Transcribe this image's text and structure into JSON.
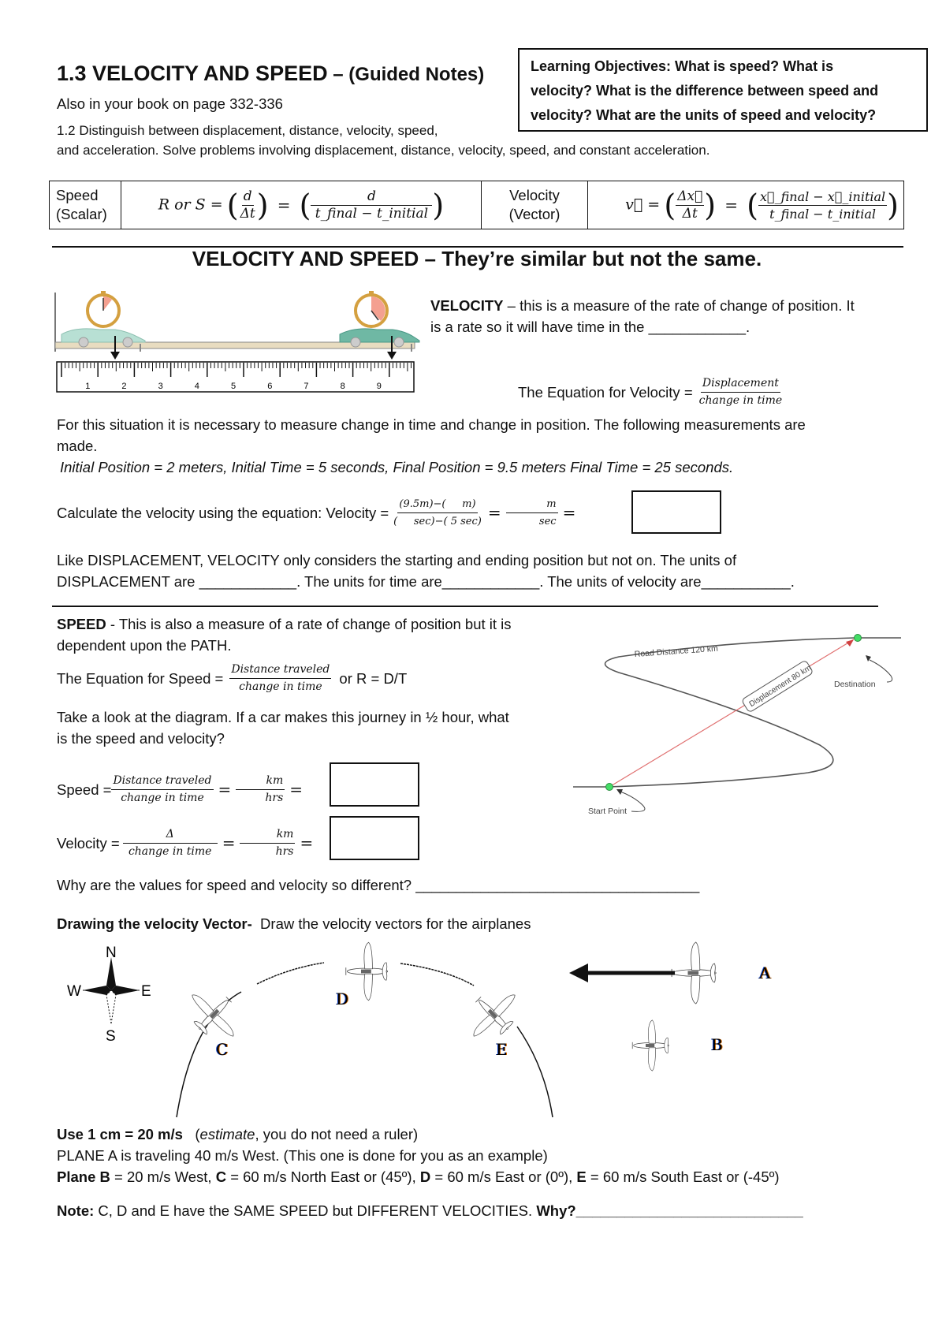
{
  "header": {
    "title_main": "1.3 VELOCITY AND SPEED",
    "title_suffix": " – (Guided Notes)",
    "book_ref": "Also in your book on page 332-336",
    "standard_line1": "1.2 Distinguish between displacement, distance, velocity, speed,",
    "standard_line2": "and acceleration. Solve problems involving displacement, distance, velocity, speed, and constant acceleration."
  },
  "objectives": {
    "line1": "Learning Objectives:  What is speed? What is",
    "line2": "velocity? What is the difference between speed and",
    "line3": "velocity? What are the units of speed and velocity?"
  },
  "formula_table": {
    "speed_label_1": "Speed",
    "speed_label_2": "(Scalar)",
    "speed_lhs": "R or S =",
    "speed_frac1_num": "d",
    "speed_frac1_den": "Δt",
    "speed_frac2_num": "d",
    "speed_frac2_den": "t_final − t_initial",
    "velocity_label_1": "Velocity",
    "velocity_label_2": "(Vector)",
    "velocity_lhs": "v⃗ =",
    "velocity_frac1_num": "Δx⃗",
    "velocity_frac1_den": "Δt",
    "velocity_frac2_num": "x⃗_final − x⃗_initial",
    "velocity_frac2_den": "t_final − t_initial"
  },
  "section_heading": "VELOCITY AND SPEED – They’re similar but not the same.",
  "ruler": {
    "labels": [
      "1",
      "2",
      "3",
      "4",
      "5",
      "6",
      "7",
      "8",
      "9"
    ]
  },
  "velocity_section": {
    "def_bold": "VELOCITY",
    "def_line1": " – this is a measure of the rate of change of position. It",
    "def_line2": "is a rate so it will have time in the ____________.",
    "equation_label": "The Equation for Velocity =",
    "equation_num": "Displacement",
    "equation_den": "change in time",
    "situation_line1": "For this situation it is necessary to measure change in time and change in position. The following measurements are",
    "situation_line2": "made.",
    "measurements": "Initial Position = 2 meters, Initial Time = 5 seconds, Final Position = 9.5 meters Final Time = 25 seconds.",
    "calc_label": "Calculate the velocity using the equation: Velocity =",
    "calc_num": "(9.5m)−(     m)",
    "calc_den": "(     sec)−( 5 sec)",
    "calc_unit_num": "m",
    "calc_unit_den": "sec",
    "units_line1": "Like DISPLACEMENT, VELOCITY only considers the starting and ending position but not on. The units of",
    "units_line2": "DISPLACEMENT are ____________. The units for time are____________.  The units of velocity are___________."
  },
  "speed_section": {
    "def_bold": "SPEED",
    "def_line1": " - This is also a measure of a rate of change of position but it is",
    "def_line2": "dependent upon the PATH.",
    "equation_label": "The Equation for Speed =",
    "equation_num": "Distance traveled",
    "equation_den": "change in time",
    "equation_alt": "or R = D/T",
    "question_line1": "Take a look at the diagram. If a car makes this journey in ½ hour, what",
    "question_line2": "is the speed and velocity?",
    "speed_calc_label": "Speed =",
    "speed_calc_num": "Distance traveled",
    "speed_calc_den": "change in time",
    "velocity_calc_label": "Velocity =",
    "velocity_calc_num": "Δ",
    "velocity_calc_den": "change in time",
    "unit_num": "km",
    "unit_den": "hrs",
    "why_question": "Why are the values for speed and velocity so different? ___________________________________"
  },
  "road_diagram": {
    "road_label": "Road Distance 120 km",
    "displacement_label": "Displacement 80 km",
    "destination_label": "Destination",
    "start_label": "Start Point"
  },
  "vector_section": {
    "heading_bold": "Drawing the velocity Vector-",
    "heading_rest": "  Draw the velocity vectors for the airplanes",
    "compass": {
      "n": "N",
      "s": "S",
      "e": "E",
      "w": "W"
    },
    "plane_labels": {
      "a": "A",
      "b": "B",
      "c": "C",
      "d": "D",
      "e": "E"
    },
    "scale_bold": "Use 1 cm = 20 m/s",
    "scale_rest_pre": "   (",
    "scale_italic": "estimate",
    "scale_rest_post": ", you do not need a ruler)",
    "plane_a_line": "PLANE A is traveling 40 m/s West. (This one is done for you as an example)",
    "plane_b_bold": "Plane B",
    "plane_b_text": " = 20 m/s West, ",
    "plane_c_bold": "C",
    "plane_c_text": " = 60 m/s North East or (45º), ",
    "plane_d_bold": "D",
    "plane_d_text": " = 60 m/s East or (0º), ",
    "plane_e_bold": "E",
    "plane_e_text": " = 60 m/s South East or (-45º)",
    "note_bold": "Note:",
    "note_text": " C, D and E have the SAME SPEED but DIFFERENT VELOCITIES. ",
    "note_why": "Why?____________________________"
  }
}
